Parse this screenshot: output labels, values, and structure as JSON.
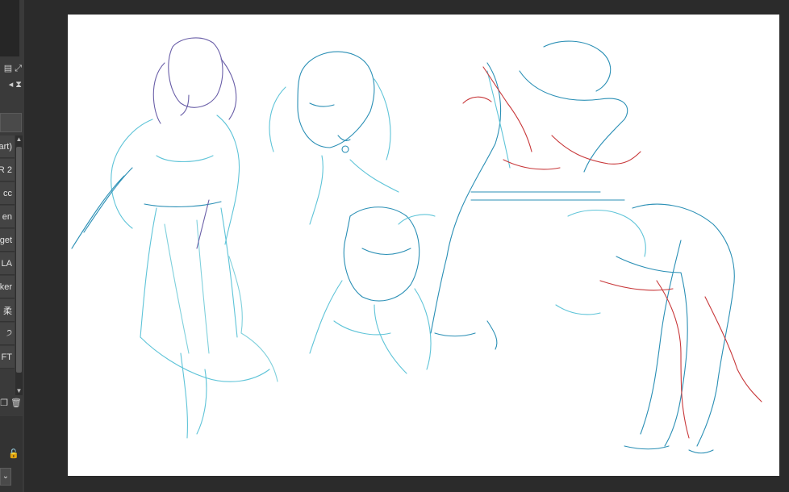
{
  "left_panel": {
    "layers": [
      {
        "label": "art)"
      },
      {
        "label": "R 2"
      },
      {
        "label": "cc"
      },
      {
        "label": "en"
      },
      {
        "label": "get"
      },
      {
        "label": "LA"
      },
      {
        "label": "ker"
      },
      {
        "label": "柔"
      },
      {
        "label": "੭"
      },
      {
        "label": "FT"
      }
    ],
    "icons": [
      "new-layer-icon",
      "resize-icon",
      "prev-icon",
      "hourglass-icon",
      "copy-icon",
      "trash-icon",
      "lock-icon",
      "chevron-down-icon"
    ]
  },
  "canvas": {
    "background": "#ffffff",
    "stroke_colors": {
      "teal": "#2a8fb5",
      "cyan": "#5fc4d8",
      "purple": "#6a5fa8",
      "red": "#c8383a"
    }
  }
}
